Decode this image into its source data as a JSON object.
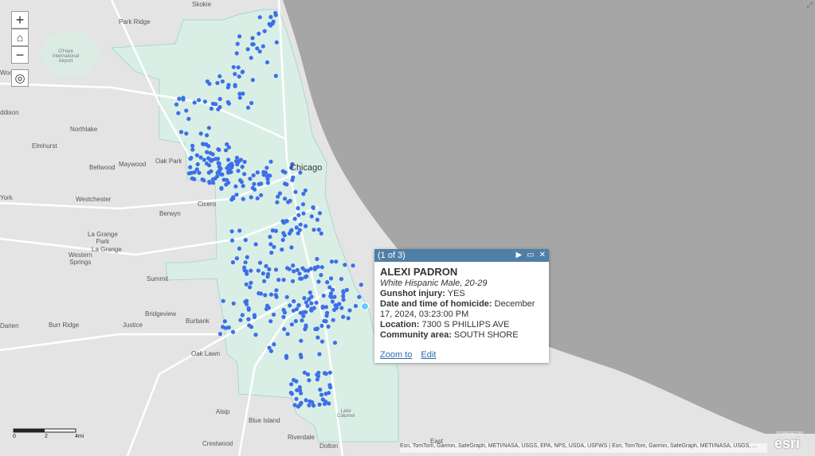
{
  "controls": {
    "zoom_in": "+",
    "home": "⌂",
    "zoom_out": "−",
    "locate": "◎"
  },
  "places": {
    "skokie": "Skokie",
    "park_ridge": "Park Ridge",
    "ohare": "O'Hare\nInternational\nAirport",
    "addison": "ddison",
    "northlake": "Northlake",
    "elmhurst": "Elmhurst",
    "bellwood": "Bellwood",
    "maywood": "Maywood",
    "oak_park": "Oak Park",
    "chicago": "Chicago",
    "york": "York",
    "westchester": "Westchester",
    "berwyn": "Berwyn",
    "cicero": "Cicero",
    "la_grange_park": "La Grange\nPark",
    "la_grange": "La Grange",
    "western_springs": "Western\nSprings",
    "summit": "Summit",
    "bridgeview": "Bridgeview",
    "burbank": "Burbank",
    "darien": "Darien",
    "burr_ridge": "Burr Ridge",
    "justice": "Justice",
    "oak_lawn": "Oak Lawn",
    "alsip": "Alsip",
    "blue_island": "Blue Island",
    "lake_calumet": "Lake\nCalumet",
    "riverdale": "Riverdale",
    "crestwood": "Crestwood",
    "dolton": "Dolton",
    "east": "East",
    "wood": "Woo",
    "lake_word": "Lake"
  },
  "popup": {
    "count": "(1 of 3)",
    "name": "ALEXI PADRON",
    "subtitle": "White Hispanic Male, 20-29",
    "gunshot_label": "Gunshot injury:",
    "gunshot_value": " YES",
    "datetime_label": "Date and time of homicide:",
    "datetime_value": " December 17, 2024, 03:23:00 PM",
    "location_label": "Location:",
    "location_value": "  7300 S PHILLIPS AVE",
    "community_label": "Community area:",
    "community_value": " SOUTH SHORE",
    "zoom_to": "Zoom to",
    "edit": "Edit"
  },
  "scale": {
    "labels": [
      "0",
      "2",
      "4mi"
    ]
  },
  "attribution": "Esri, TomTom, Garmin, SafeGraph, METI/NASA, USGS, EPA, NPS, USDA, USFWS | Esri, TomTom, Garmin, SafeGraph, METI/NASA, USGS, ...",
  "esri_logo": "esri",
  "esri_powered": "POWERED BY",
  "colors": {
    "water": "#a3a3a3",
    "land": "#e6e6e6",
    "city": "#daf0e8",
    "point": "#3d6fe8",
    "popup_header": "#4f7fa6"
  }
}
